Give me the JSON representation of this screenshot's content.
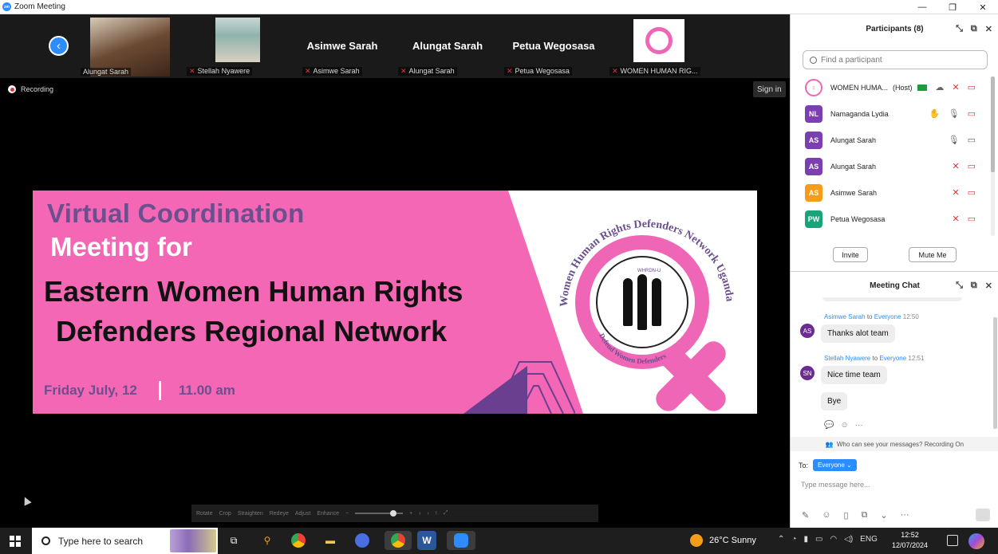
{
  "window": {
    "title": "Zoom Meeting",
    "controls": [
      "—",
      "❐",
      "✕"
    ]
  },
  "strip": {
    "tiles": [
      {
        "label": "Alungat Sarah",
        "type": "video"
      },
      {
        "label": "Stellah Nyawere",
        "type": "video",
        "muted": true
      },
      {
        "label": "Asimwe Sarah",
        "display": "Asimwe Sarah",
        "muted": true
      },
      {
        "label": "Alungat Sarah",
        "display": "Alungat Sarah",
        "muted": true
      },
      {
        "label": "Petua Wegosasa",
        "display": "Petua Wegosasa",
        "muted": true
      },
      {
        "label": "WOMEN HUMAN RIG...",
        "type": "logo",
        "muted": true
      }
    ]
  },
  "recording_label": "Recording",
  "signin_label": "Sign in",
  "banner": {
    "line1": "Virtual Coordination",
    "line2": "Meeting for",
    "line3": "Eastern Women Human Rights",
    "line4": "Defenders Regional Network",
    "date": "Friday July, 12",
    "time": "11.00 am",
    "emblem_top_text": "Women Human Rights Defenders Network Uganda",
    "emblem_small_text": "WHRDN-U",
    "emblem_bottom_text": "Defend Women Defenders",
    "colors": {
      "pink": "#f467b4",
      "purple": "#6b4f8f"
    }
  },
  "viewbar": {
    "items": [
      "Rotate",
      "Crop",
      "Straighten",
      "Redeye",
      "Adjust",
      "Enhance"
    ]
  },
  "participants": {
    "title": "Participants (8)",
    "search_placeholder": "Find a participant",
    "list": [
      {
        "initials": "",
        "name": "WOMEN HUMA...",
        "host": "(Host)",
        "color": "#ffffff",
        "is_logo": true
      },
      {
        "initials": "NL",
        "name": "Namaganda Lydia",
        "color": "#7b3fb0",
        "hand": true
      },
      {
        "initials": "AS",
        "name": "Alungat Sarah",
        "color": "#7b3fb0"
      },
      {
        "initials": "AS",
        "name": "Alungat Sarah",
        "color": "#7b3fb0"
      },
      {
        "initials": "AS",
        "name": "Asimwe Sarah",
        "color": "#f59d1a"
      },
      {
        "initials": "PW",
        "name": "Petua Wegosasa",
        "color": "#1aa37a"
      }
    ],
    "invite_label": "Invite",
    "mute_me_label": "Mute Me"
  },
  "chat": {
    "title": "Meeting Chat",
    "messages": [
      {
        "from": "Asimwe Sarah",
        "to_label": "to",
        "to": "Everyone",
        "time": "12:50",
        "initials": "AS",
        "texts": [
          "Thanks alot team"
        ]
      },
      {
        "from": "Stellah Nyawere",
        "to_label": "to",
        "to": "Everyone",
        "time": "12:51",
        "initials": "SN",
        "texts": [
          "Nice time team",
          "Bye"
        ]
      }
    ],
    "who_can_see": "Who can see your messages? Recording On",
    "to_label": "To:",
    "to_value": "Everyone ⌄",
    "placeholder": "Type message here..."
  },
  "taskbar": {
    "search_placeholder": "Type here to search",
    "weather": "26°C  Sunny",
    "lang": "ENG",
    "time": "12:52",
    "date": "12/07/2024"
  }
}
